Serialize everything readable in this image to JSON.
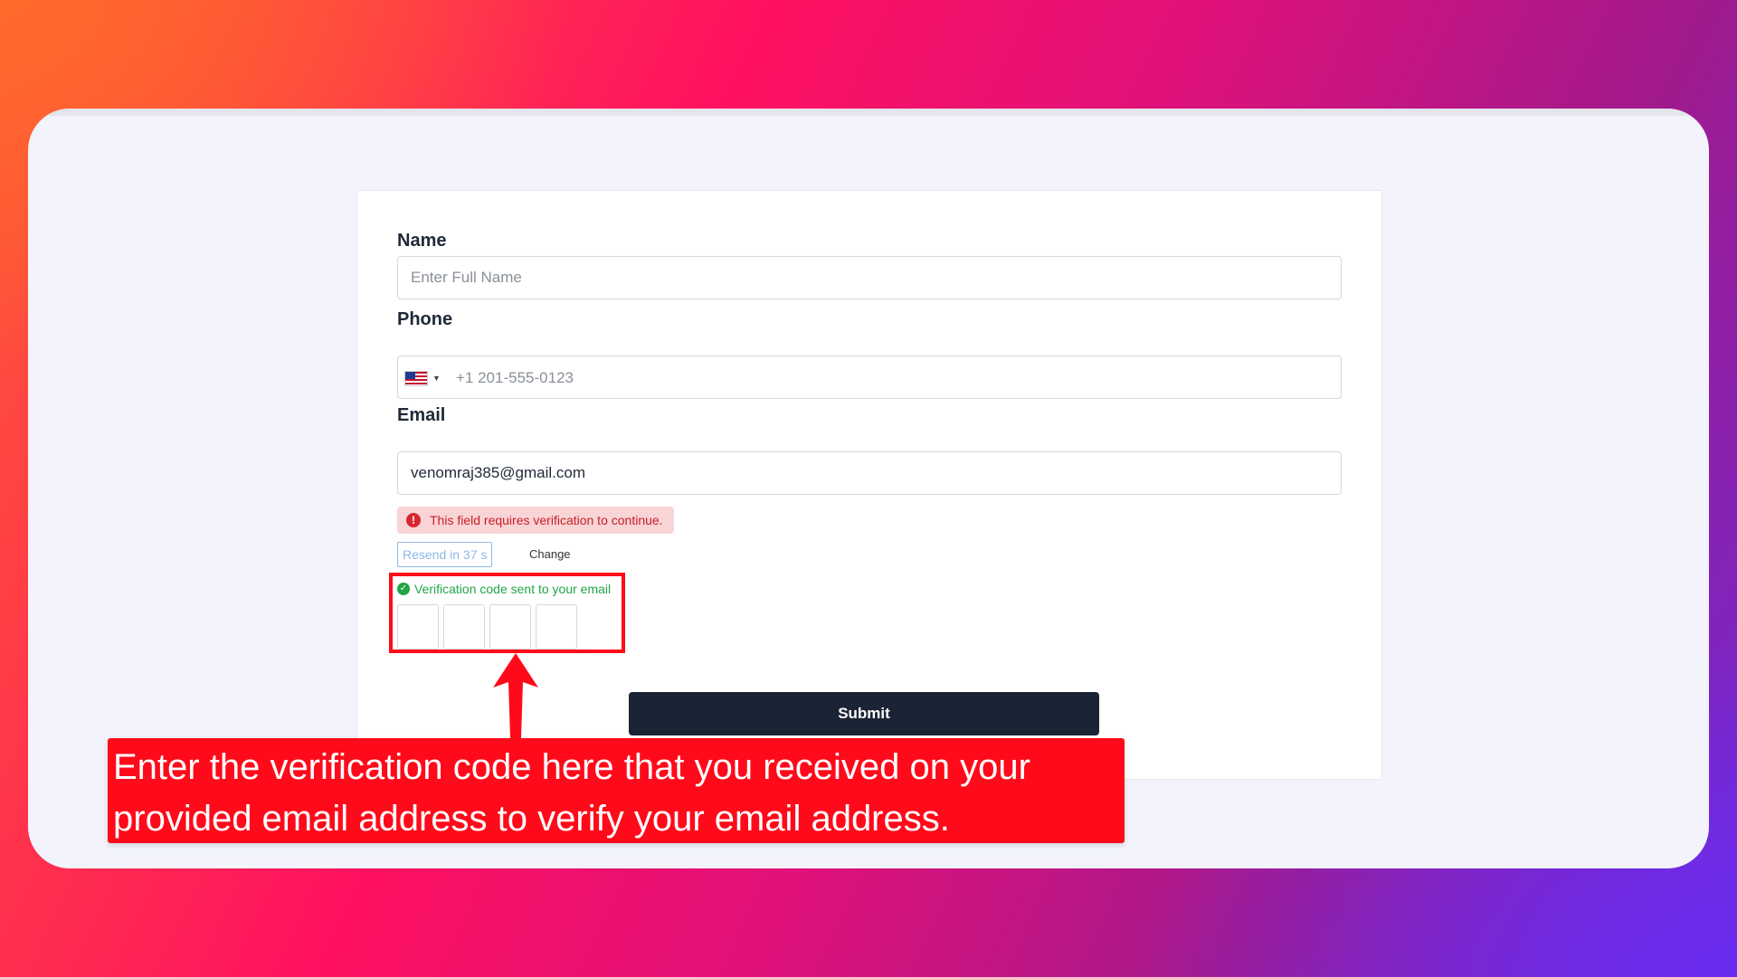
{
  "form": {
    "name_label": "Name",
    "name_placeholder": "Enter Full Name",
    "phone_label": "Phone",
    "phone_placeholder": "+1 201-555-0123",
    "phone_country_icon": "us-flag-icon",
    "email_label": "Email",
    "email_value": "venomraj385@gmail.com",
    "error_text": "This field requires verification to continue.",
    "error_icon": "!",
    "resend_label": "Resend in 37 s",
    "change_label": "Change",
    "verify_status_text": "Verification code sent to your email",
    "verify_icon": "✓",
    "code_boxes": [
      "",
      "",
      "",
      ""
    ],
    "submit_label": "Submit"
  },
  "annotation": {
    "callout_text": "Enter the verification code here that you received on your provided email address to verify your email address.",
    "highlight_color": "#ff0a1a"
  },
  "colors": {
    "submit_bg": "#1b2435",
    "error_bg": "#f8d4d6",
    "error_text": "#c81e24",
    "success_text": "#22a447",
    "resend_text": "#8fb8e8"
  }
}
